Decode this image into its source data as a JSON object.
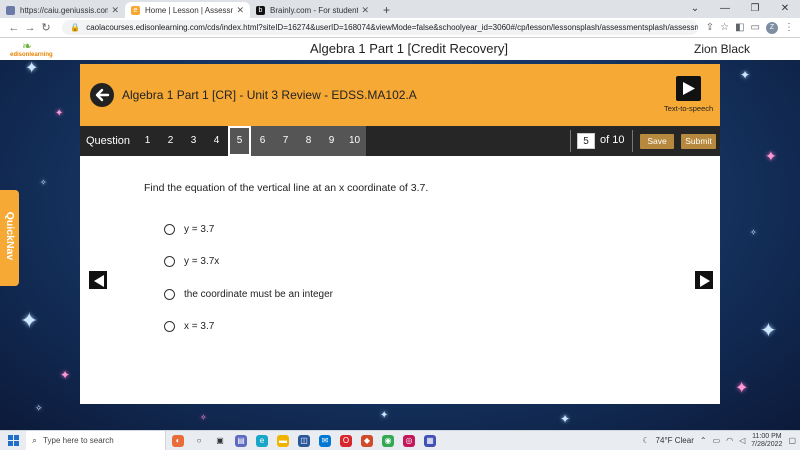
{
  "browser": {
    "tabs": [
      {
        "title": "https://caiu.geniussis.com/FEDe...",
        "favicon": "#6c7aa8",
        "active": false
      },
      {
        "title": "Home | Lesson | Assessment Play",
        "favicon": "#f7a935",
        "active": true
      },
      {
        "title": "Brainly.com - For students. By st...",
        "favicon": "#111111",
        "active": false
      }
    ],
    "new_tab": "+",
    "url": "caolacourses.edisonlearning.com/cds/index.html?siteID=16274&userID=168074&viewMode=false&schoolyear_id=3060#/cp/lesson/lessonsplash/assessmentsplash/assessmentplayer",
    "avatar_letter": "Z"
  },
  "app": {
    "logo_text": "edisonlearning",
    "course_title": "Algebra 1 Part 1 [Credit Recovery]",
    "user_name": "Zion Black"
  },
  "banner": {
    "lesson_title": "Algebra 1 Part 1 [CR] - Unit 3 Review - EDSS.MA102.A",
    "tts_label": "Text-to-speech"
  },
  "question_bar": {
    "label": "Question",
    "numbers": [
      "1",
      "2",
      "3",
      "4",
      "5",
      "6",
      "7",
      "8",
      "9",
      "10"
    ],
    "current_index": 4,
    "current_value": "5",
    "of_label": "of 10",
    "save_label": "Save",
    "submit_label": "Submit"
  },
  "question": {
    "text": "Find the equation of the vertical line at an x coordinate of 3.7.",
    "choices": [
      "y = 3.7",
      "y = 3.7x",
      "the coordinate must be an integer",
      "x = 3.7"
    ]
  },
  "quicknav_label": "QuickNav",
  "taskbar": {
    "search_placeholder": "Type here to search",
    "weather": "74°F  Clear",
    "time": "11:00 PM",
    "date": "7/28/2022"
  },
  "colors": {
    "accent_orange": "#f7a935",
    "question_bar": "#262626",
    "button_gold": "#b6893e"
  }
}
